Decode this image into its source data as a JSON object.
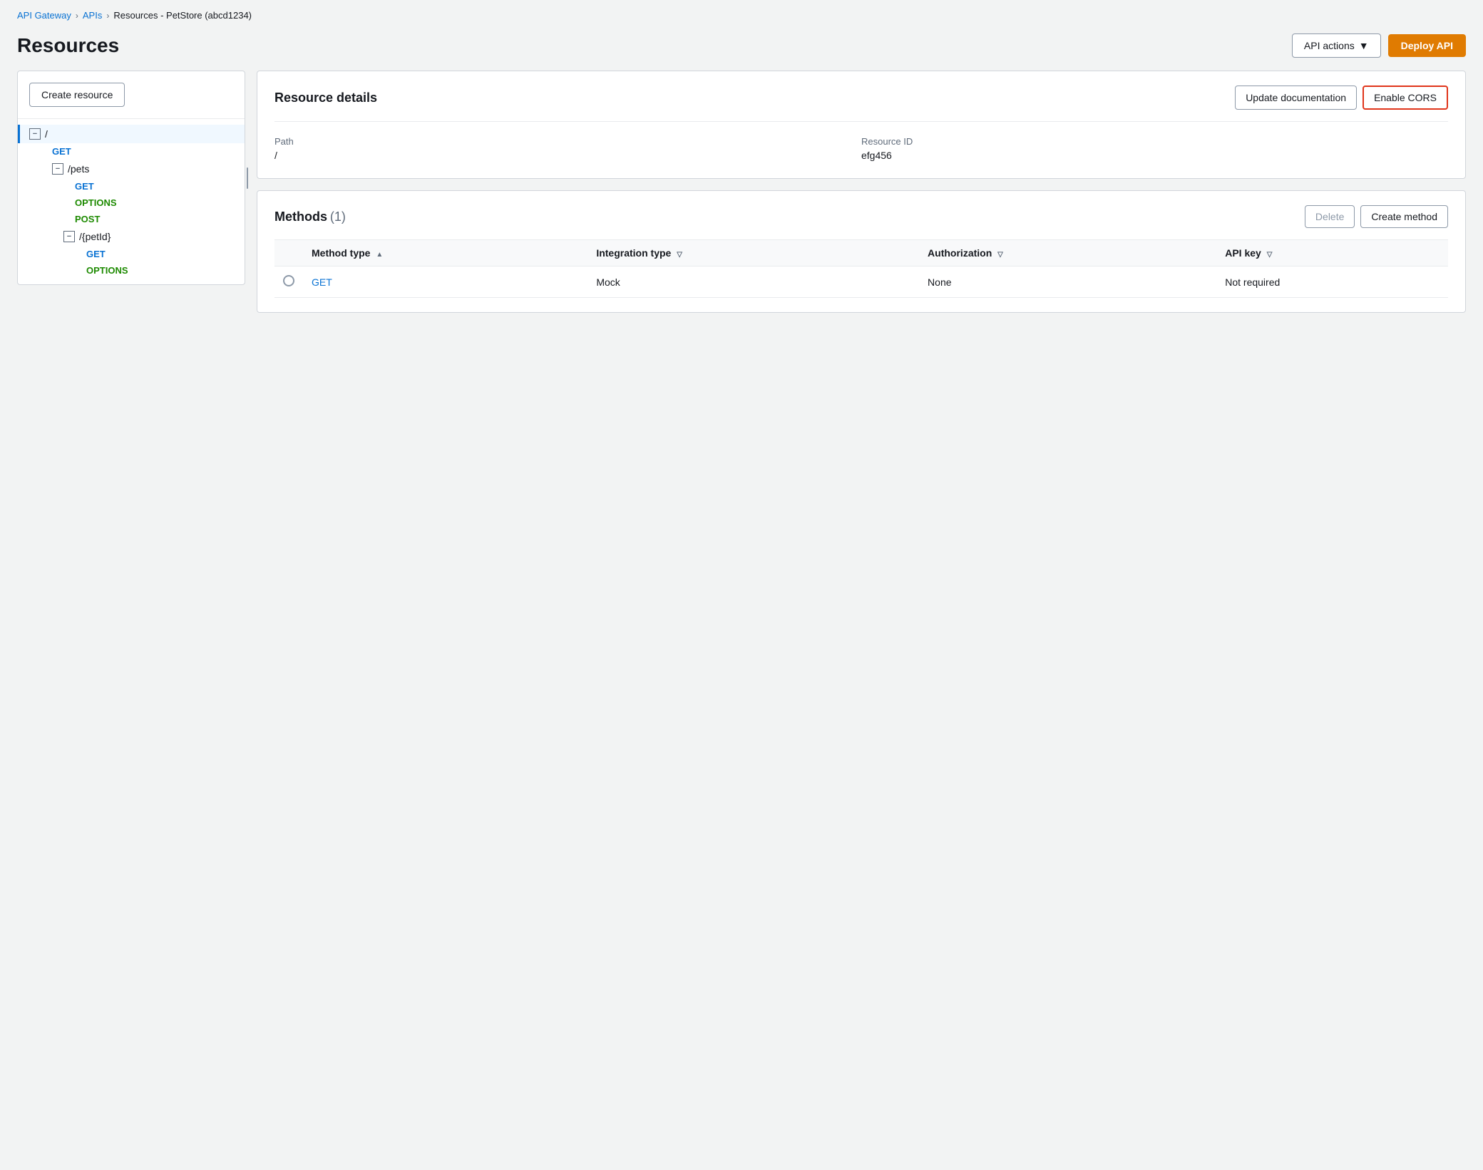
{
  "breadcrumb": {
    "items": [
      {
        "label": "API Gateway",
        "href": "#"
      },
      {
        "label": "APIs",
        "href": "#"
      },
      {
        "label": "Resources - PetStore (abcd1234)",
        "href": null
      }
    ]
  },
  "header": {
    "title": "Resources",
    "api_actions_label": "API actions",
    "deploy_label": "Deploy API"
  },
  "left_panel": {
    "create_resource_label": "Create resource",
    "tree": [
      {
        "type": "resource",
        "icon": "−",
        "label": "/",
        "selected": true,
        "children": [
          {
            "type": "method",
            "label": "GET",
            "method": "get"
          },
          {
            "type": "resource",
            "icon": "−",
            "label": "/pets",
            "children": [
              {
                "type": "method",
                "label": "GET",
                "method": "get"
              },
              {
                "type": "method",
                "label": "OPTIONS",
                "method": "options"
              },
              {
                "type": "method",
                "label": "POST",
                "method": "post"
              },
              {
                "type": "resource",
                "icon": "−",
                "label": "/{petId}",
                "children": [
                  {
                    "type": "method",
                    "label": "GET",
                    "method": "get"
                  },
                  {
                    "type": "method",
                    "label": "OPTIONS",
                    "method": "options"
                  }
                ]
              }
            ]
          }
        ]
      }
    ]
  },
  "resource_details": {
    "title": "Resource details",
    "update_doc_label": "Update documentation",
    "enable_cors_label": "Enable CORS",
    "path_label": "Path",
    "path_value": "/",
    "resource_id_label": "Resource ID",
    "resource_id_value": "efg456"
  },
  "methods": {
    "title": "Methods",
    "count": "(1)",
    "delete_label": "Delete",
    "create_method_label": "Create method",
    "columns": [
      {
        "label": "Method type",
        "sortable": true,
        "sort_dir": "asc"
      },
      {
        "label": "Integration type",
        "sortable": true,
        "sort_dir": "desc"
      },
      {
        "label": "Authorization",
        "sortable": true,
        "sort_dir": "desc"
      },
      {
        "label": "API key",
        "sortable": true,
        "sort_dir": "desc"
      }
    ],
    "rows": [
      {
        "method": "GET",
        "integration_type": "Mock",
        "authorization": "None",
        "api_key": "Not required"
      }
    ]
  }
}
